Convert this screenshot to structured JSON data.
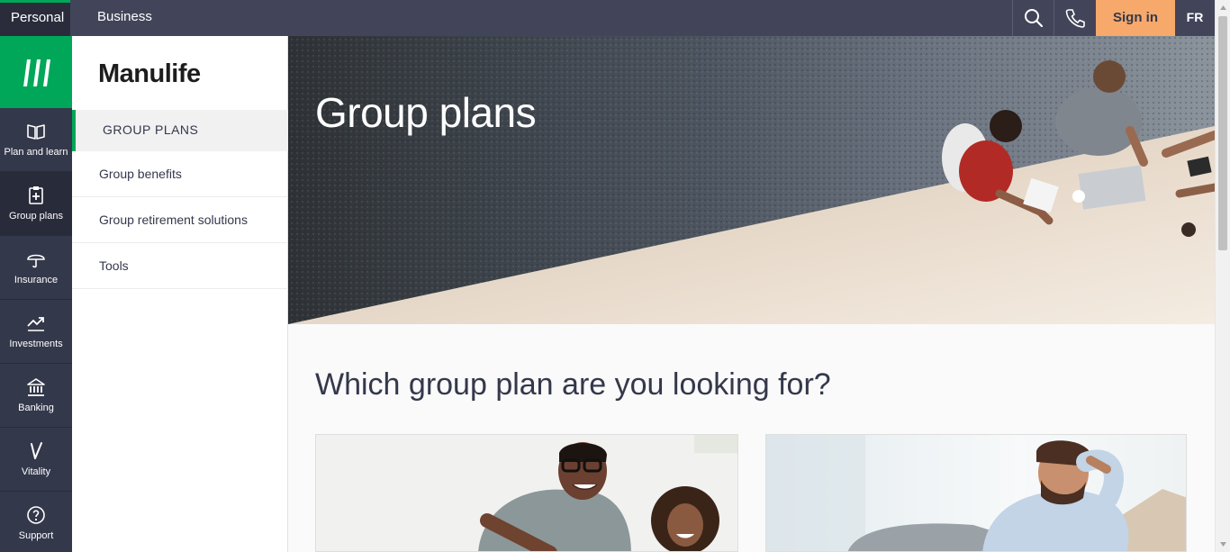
{
  "topbar": {
    "tabs": [
      {
        "label": "Personal"
      },
      {
        "label": "Business"
      }
    ],
    "search_icon": "search-icon",
    "phone_icon": "phone-icon",
    "signin_label": "Sign in",
    "lang_label": "FR"
  },
  "rail": {
    "logo_icon": "manulife-logo-icon",
    "items": [
      {
        "label": "Plan and learn",
        "icon": "book-icon"
      },
      {
        "label": "Group plans",
        "icon": "clipboard-plus-icon"
      },
      {
        "label": "Insurance",
        "icon": "umbrella-icon"
      },
      {
        "label": "Investments",
        "icon": "trend-up-icon"
      },
      {
        "label": "Banking",
        "icon": "bank-icon"
      },
      {
        "label": "Vitality",
        "icon": "vitality-check-icon"
      },
      {
        "label": "Support",
        "icon": "question-icon"
      }
    ]
  },
  "subnav": {
    "brand": "Manulife",
    "heading": "GROUP PLANS",
    "items": [
      {
        "label": "Group benefits"
      },
      {
        "label": "Group retirement solutions"
      },
      {
        "label": "Tools"
      }
    ]
  },
  "hero": {
    "title": "Group plans"
  },
  "main": {
    "section_title": "Which group plan are you looking for?"
  },
  "colors": {
    "brand_green": "#00a758",
    "nav_dark": "#424559",
    "rail_dark": "#34384b",
    "signin_orange": "#f6a96b"
  }
}
